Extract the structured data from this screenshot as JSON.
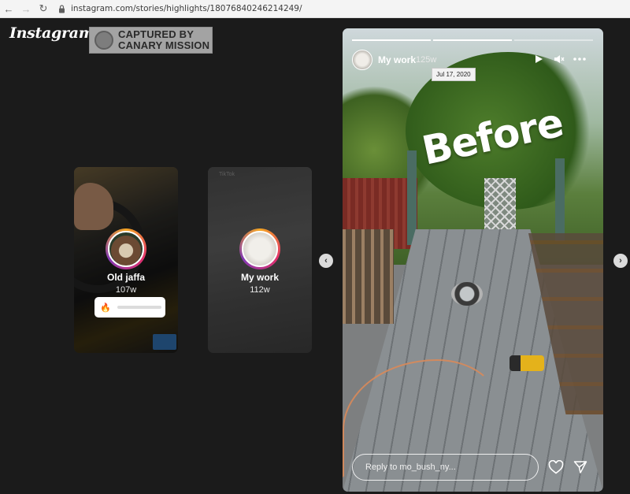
{
  "browser": {
    "back_icon": "arrow-left-icon",
    "forward_icon": "arrow-right-icon",
    "reload_icon": "reload-icon",
    "url": "instagram.com/stories/highlights/18076840246214249/"
  },
  "app": {
    "logo_text": "Instagram"
  },
  "watermark": {
    "text_line1": "CAPTURED BY",
    "text_line2": "CANARY MISSION"
  },
  "previews": [
    {
      "name": "Old jaffa",
      "time": "107w",
      "poll_emoji": "🔥"
    },
    {
      "name": "My work",
      "time": "112w",
      "tag": "TikTok"
    }
  ],
  "story": {
    "username": "My work",
    "age": "125w",
    "date_tooltip": "Jul 17, 2020",
    "sticker_text": "Before",
    "progress_segments": 3,
    "progress_done": 2,
    "reply_placeholder": "Reply to mo_bush_ny...",
    "icons": [
      "play-icon",
      "mute-icon",
      "more-icon",
      "heart-icon",
      "send-icon"
    ]
  },
  "navigation": {
    "prev_icon": "chevron-left-icon",
    "next_icon": "chevron-right-icon"
  },
  "colors": {
    "background": "#1b1b1b",
    "story_ring_start": "#f5a623",
    "story_ring_mid": "#e1306c",
    "story_ring_end": "#833ab4"
  }
}
